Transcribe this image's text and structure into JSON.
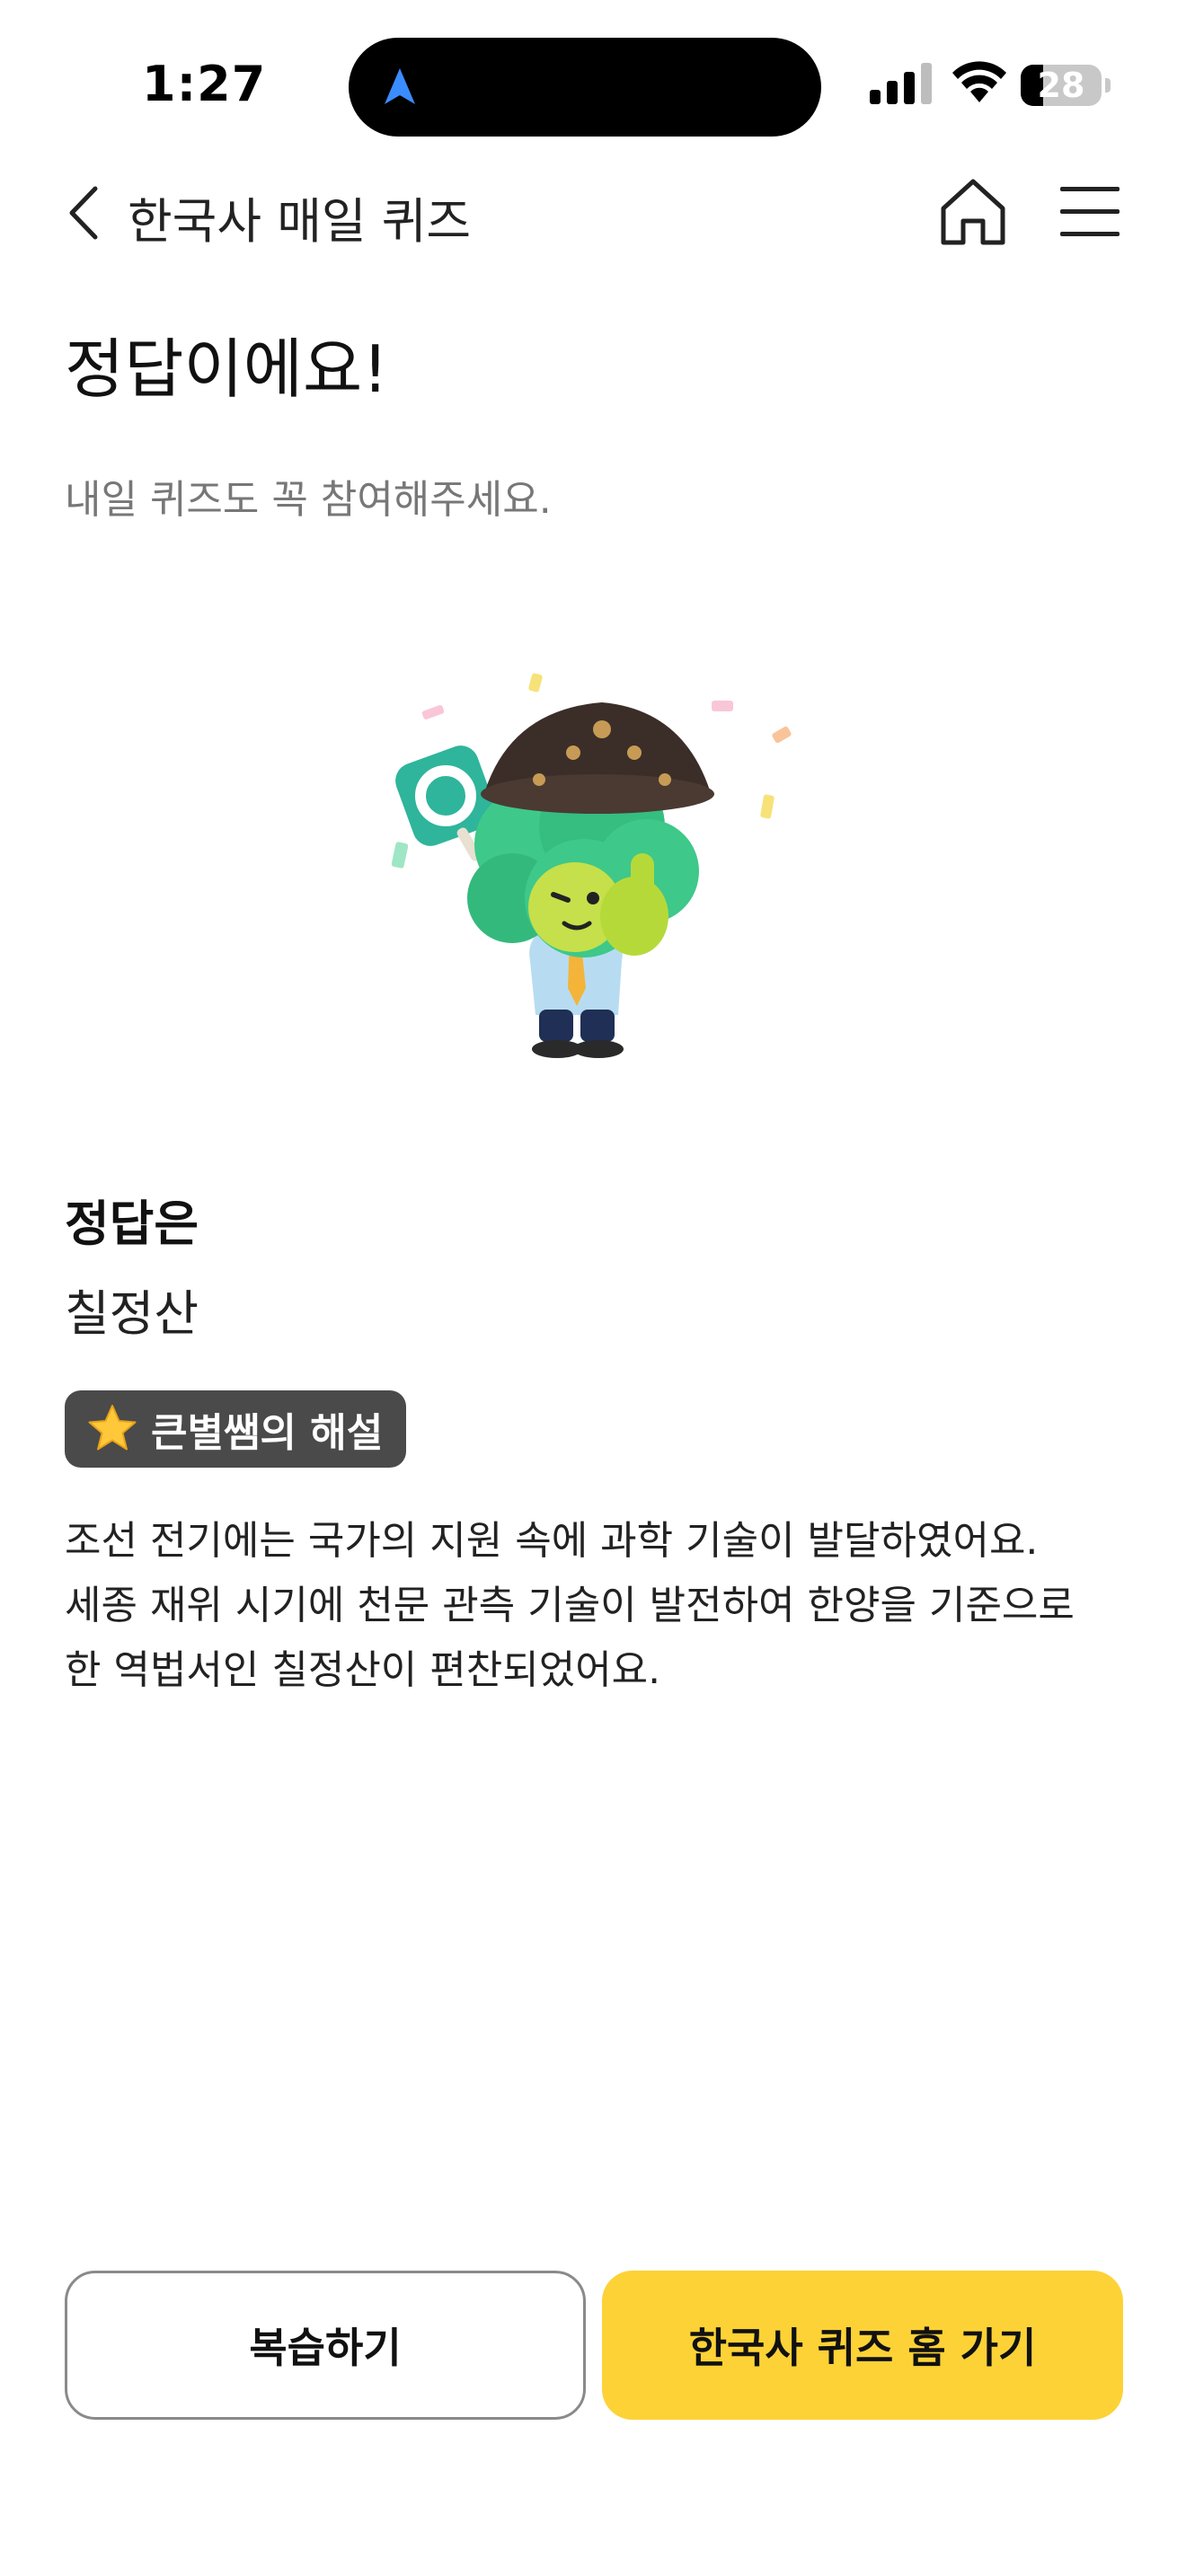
{
  "status_bar": {
    "time": "1:27",
    "battery_percent": "28",
    "battery_level": 0.28
  },
  "header": {
    "title": "한국사 매일 퀴즈"
  },
  "result": {
    "title": "정답이에요!",
    "subtitle": "내일 퀴즈도 꼭 참여해주세요."
  },
  "answer": {
    "heading": "정답은",
    "value": "칠정산"
  },
  "explanation": {
    "badge_label": "큰별쌤의 해설",
    "lines": [
      "조선 전기에는 국가의 지원 속에 과학 기술이 발달하였어요.",
      "세종 재위 시기에 천문 관측 기술이 발전하여 한양을 기준으로",
      "한 역법서인 칠정산이 편찬되었어요."
    ]
  },
  "buttons": {
    "review_label": "복습하기",
    "home_label": "한국사 퀴즈 홈 가기"
  },
  "colors": {
    "accent_yellow": "#fdd236",
    "badge_bg": "#4a4a4a",
    "character_green": "#3ec88a"
  },
  "icons": {
    "back": "chevron-left-icon",
    "home": "home-icon",
    "menu": "hamburger-menu-icon",
    "star": "star-icon",
    "location": "navigation-arrow-icon"
  }
}
